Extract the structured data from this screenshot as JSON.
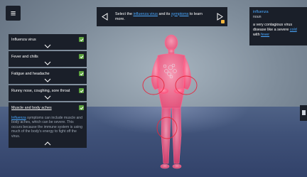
{
  "instruction": {
    "text_before": "Select the ",
    "link1": "influenza virus",
    "text_mid": " and its ",
    "link2": "symptoms",
    "text_after": " to learn more."
  },
  "definition": {
    "term": "influenza",
    "part_of_speech": "noun",
    "text_before": "a very contagious virus disease like a severe ",
    "link1": "cold",
    "text_mid": " with ",
    "link2": "fever"
  },
  "symptoms": [
    {
      "label": "Influenza virus",
      "checked": true
    },
    {
      "label": "Fever and chills",
      "checked": true
    },
    {
      "label": "Fatigue and headache",
      "checked": true
    },
    {
      "label": "Runny nose, coughing, sore throat",
      "checked": true
    },
    {
      "label": "Muscle and body aches",
      "checked": true,
      "desc_link": "Influenza",
      "desc_rest": " symptoms can include muscle and body aches, which can be severe. This occurs because the immune system is using much of the body's energy to fight off the virus."
    }
  ],
  "icons": {
    "menu": "hamburger-menu-icon",
    "prev": "triangle-left-icon",
    "next": "triangle-right-icon",
    "check": "checkmark-icon",
    "expand": "chevron-down-icon",
    "collapse": "chevron-up-icon"
  },
  "colors": {
    "panel": "#1a1f29",
    "link": "#4aa8ff",
    "check": "#5ea33f",
    "figure_glow": "#ff4c7a"
  }
}
